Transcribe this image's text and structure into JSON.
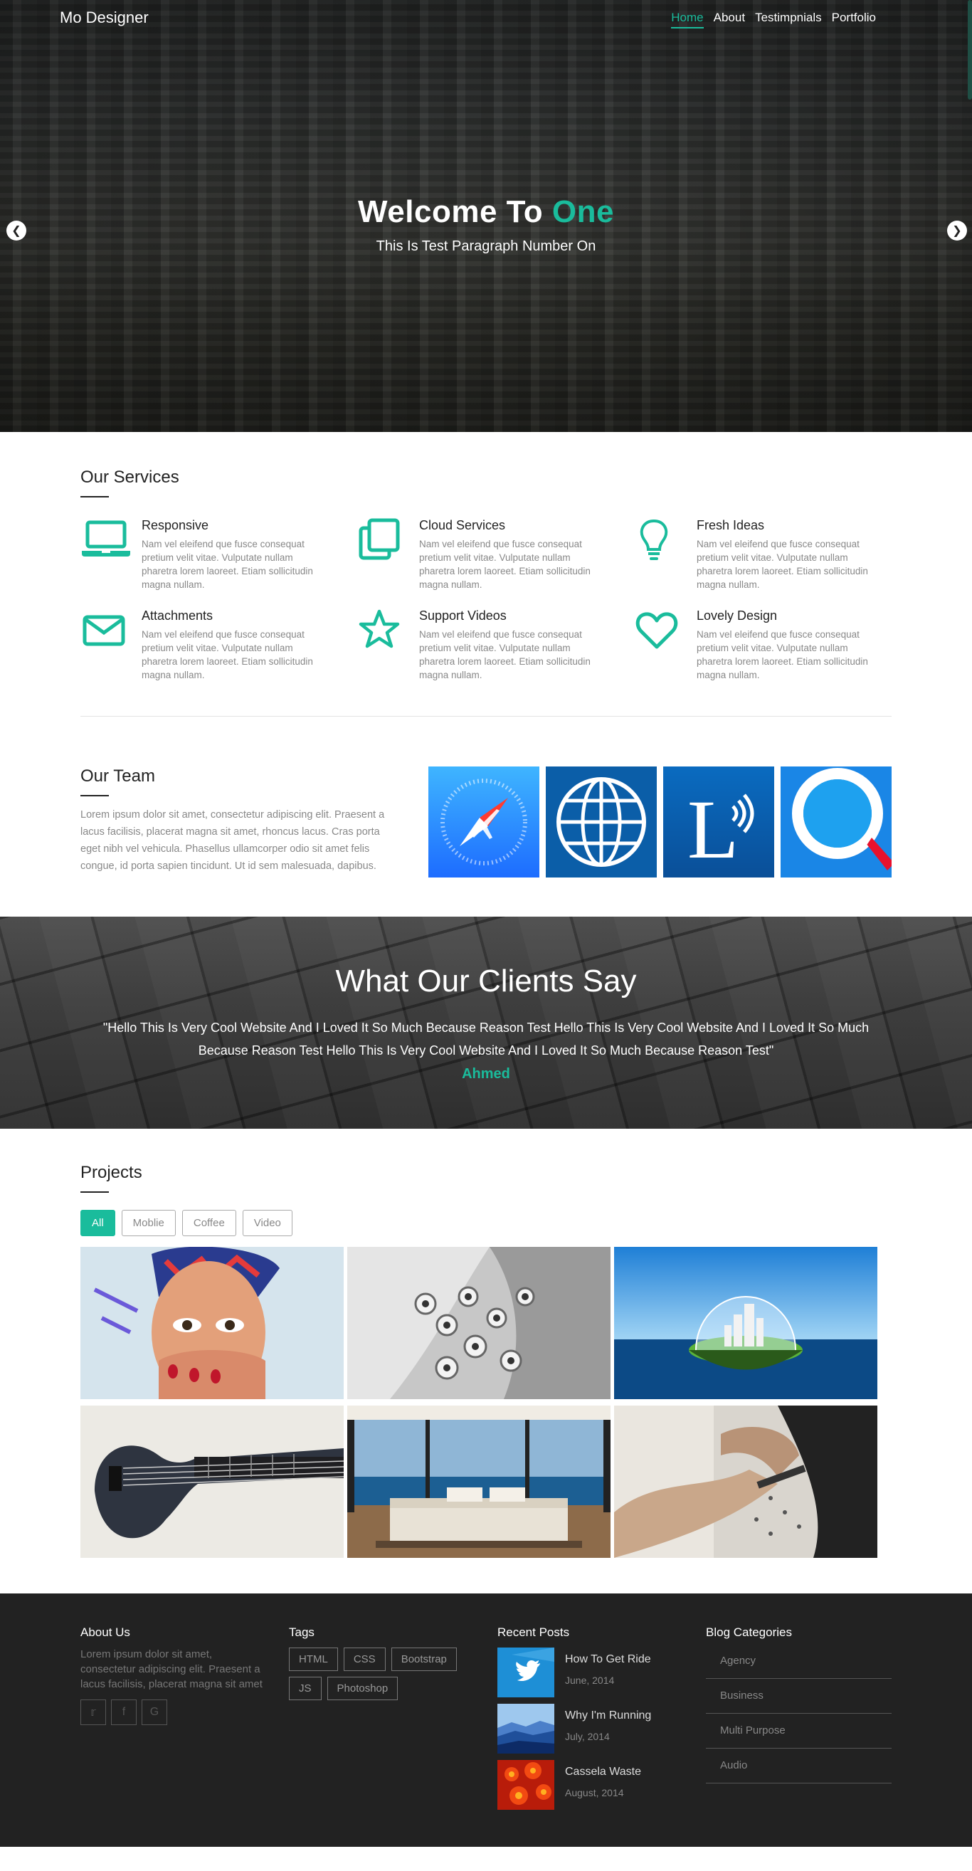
{
  "navbar": {
    "brand": "Mo Designer",
    "links": [
      "Home",
      "About",
      "Testimpnials",
      "Portfolio"
    ],
    "active": "Home"
  },
  "hero": {
    "title_part1": "Welcome To",
    "title_highlight": "One",
    "subtitle": "This Is Test Paragraph Number On",
    "prev_icon": "chevron-left-icon",
    "next_icon": "chevron-right-icon"
  },
  "services": {
    "title": "Our Services",
    "items": [
      {
        "icon": "laptop-icon",
        "title": "Responsive",
        "text": "Nam vel eleifend que fusce consequat pretium velit vitae. Vulputate nullam pharetra lorem laoreet. Etiam sollicitudin magna nullam."
      },
      {
        "icon": "copy-icon",
        "title": "Cloud Services",
        "text": "Nam vel eleifend que fusce consequat pretium velit vitae. Vulputate nullam pharetra lorem laoreet. Etiam sollicitudin magna nullam."
      },
      {
        "icon": "lightbulb-icon",
        "title": "Fresh Ideas",
        "text": "Nam vel eleifend que fusce consequat pretium velit vitae. Vulputate nullam pharetra lorem laoreet. Etiam sollicitudin magna nullam."
      },
      {
        "icon": "envelope-icon",
        "title": "Attachments",
        "text": "Nam vel eleifend que fusce consequat pretium velit vitae. Vulputate nullam pharetra lorem laoreet. Etiam sollicitudin magna nullam."
      },
      {
        "icon": "star-icon",
        "title": "Support Videos",
        "text": "Nam vel eleifend que fusce consequat pretium velit vitae. Vulputate nullam pharetra lorem laoreet. Etiam sollicitudin magna nullam."
      },
      {
        "icon": "heart-icon",
        "title": "Lovely Design",
        "text": "Nam vel eleifend que fusce consequat pretium velit vitae. Vulputate nullam pharetra lorem laoreet. Etiam sollicitudin magna nullam."
      }
    ]
  },
  "team": {
    "title": "Our Team",
    "text": "Lorem ipsum dolor sit amet, consectetur adipiscing elit. Praesent a lacus facilisis, placerat magna sit amet, rhoncus lacus. Cras porta eget nibh vel vehicula. Phasellus ullamcorper odio sit amet felis congue, id porta sapien tincidunt. Ut id sem malesuada, dapibus.",
    "images": [
      "safari-compass-icon",
      "globe-icon",
      "l-letter-icon",
      "search-magnifier-icon"
    ]
  },
  "clients": {
    "title": "What Our Clients Say",
    "quote": "\"Hello This Is Very Cool Website And I Loved It So Much Because Reason Test Hello This Is Very Cool Website And I Loved It So Much Because Reason Test Hello This Is Very Cool Website And I Loved It So Much Because Reason Test\"",
    "author": "Ahmed"
  },
  "projects": {
    "title": "Projects",
    "filters": [
      "All",
      "Moblie",
      "Coffee",
      "Video"
    ],
    "active_filter": "All",
    "images": [
      "painted-face-photo",
      "white-tubes-photo",
      "island-dome-photo",
      "bass-guitar-photo",
      "bedroom-ocean-photo",
      "hands-tool-photo"
    ]
  },
  "footer": {
    "about": {
      "title": "About Us",
      "text": "Lorem ipsum dolor sit amet, consectetur adipiscing elit. Praesent a lacus facilisis, placerat magna sit amet",
      "socials": [
        "twitter-icon",
        "facebook-icon",
        "google-icon"
      ]
    },
    "tags": {
      "title": "Tags",
      "items": [
        "HTML",
        "CSS",
        "Bootstrap",
        "JS",
        "Photoshop"
      ]
    },
    "recent": {
      "title": "Recent Posts",
      "items": [
        {
          "title": "How To Get Ride",
          "date": "June, 2014"
        },
        {
          "title": "Why I'm Running",
          "date": "July, 2014"
        },
        {
          "title": "Cassela Waste",
          "date": "August, 2014"
        }
      ]
    },
    "categories": {
      "title": "Blog Categories",
      "items": [
        "Agency",
        "Business",
        "Multi Purpose",
        "Audio"
      ]
    }
  },
  "colors": {
    "accent": "#1abc9c",
    "footer_bg": "#222222"
  }
}
